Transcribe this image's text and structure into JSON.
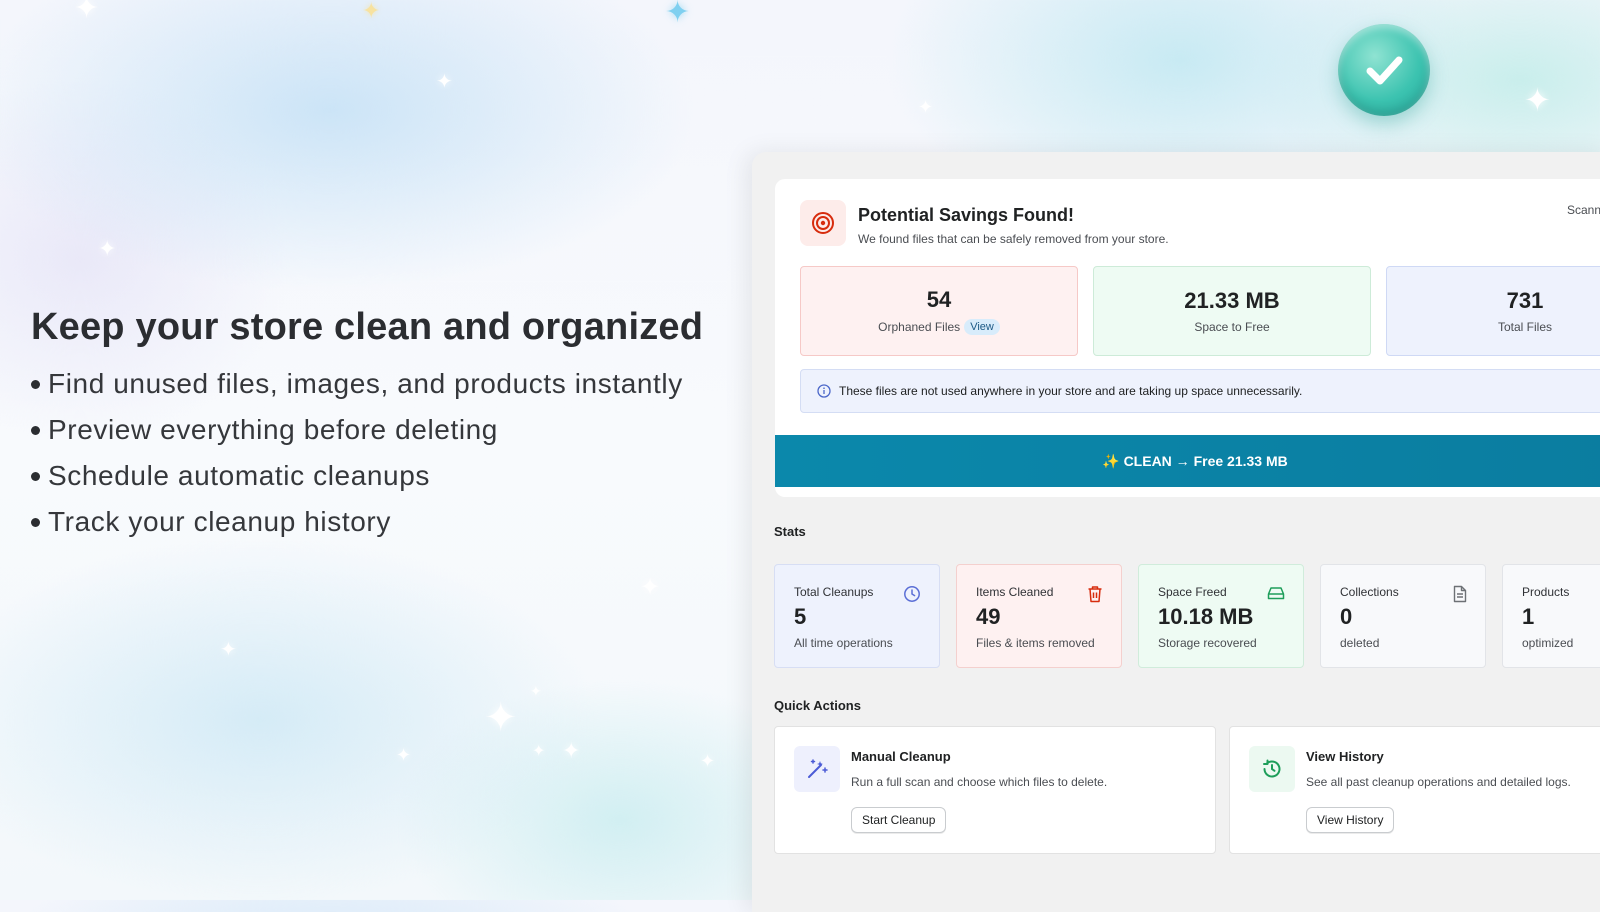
{
  "hero": {
    "heading": "Keep your store clean and organized",
    "bullets": [
      "Find unused files, images, and products instantly",
      "Preview everything before deleting",
      "Schedule automatic cleanups",
      "Track your cleanup history"
    ]
  },
  "badge": {
    "icon": "checkmark-icon",
    "color": "#3cc3b0"
  },
  "savings": {
    "title": "Potential Savings Found!",
    "subtitle": "We found files that can be safely removed from your store.",
    "scanned_label": "Scanne",
    "icon": "target-icon",
    "metrics": [
      {
        "value": "54",
        "label": "Orphaned Files",
        "link": "View",
        "color": "#fef1f1"
      },
      {
        "value": "21.33 MB",
        "label": "Space to Free",
        "color": "#eefbf3"
      },
      {
        "value": "731",
        "label": "Total Files",
        "color": "#eef2fd"
      }
    ],
    "notice": "These files are not used anywhere in your store and are taking up space unnecessarily.",
    "clean_button": "✨ CLEAN → Free 21.33 MB",
    "accent": "#0b88ab"
  },
  "stats": {
    "title": "Stats",
    "items": [
      {
        "label": "Total Cleanups",
        "value": "5",
        "sub": "All time operations",
        "icon": "clock-icon"
      },
      {
        "label": "Items Cleaned",
        "value": "49",
        "sub": "Files & items removed",
        "icon": "trash-icon"
      },
      {
        "label": "Space Freed",
        "value": "10.18 MB",
        "sub": "Storage recovered",
        "icon": "drive-icon"
      },
      {
        "label": "Collections",
        "value": "0",
        "sub": "deleted",
        "icon": "document-icon"
      },
      {
        "label": "Products",
        "value": "1",
        "sub": "optimized"
      }
    ]
  },
  "quick_actions": {
    "title": "Quick Actions",
    "items": [
      {
        "title": "Manual Cleanup",
        "desc": "Run a full scan and choose which files to delete.",
        "button": "Start Cleanup",
        "icon": "magic-wand-icon"
      },
      {
        "title": "View History",
        "desc": "See all past cleanup operations and detailed logs.",
        "button": "View History",
        "icon": "history-icon"
      }
    ]
  }
}
